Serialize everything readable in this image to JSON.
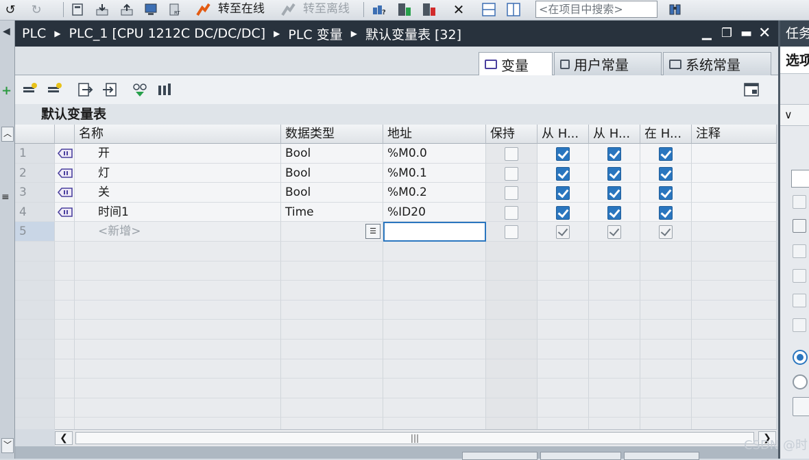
{
  "toolbar": {
    "go_online": "转至在线",
    "go_offline": "转至离线",
    "search_placeholder": "<在项目中搜索>"
  },
  "breadcrumb": [
    "PLC",
    "PLC_1 [CPU 1212C DC/DC/DC]",
    "PLC 变量",
    "默认变量表 [32]"
  ],
  "right_panel": {
    "title": "任务",
    "subtitle": "选项"
  },
  "tabs": [
    {
      "label": "变量",
      "active": true
    },
    {
      "label": "用户常量",
      "active": false
    },
    {
      "label": "系统常量",
      "active": false
    }
  ],
  "table_title": "默认变量表",
  "columns": [
    "名称",
    "数据类型",
    "地址",
    "保持",
    "从 H...",
    "从 H...",
    "在 H...",
    "注释"
  ],
  "rows": [
    {
      "num": "1",
      "name": "开",
      "type": "Bool",
      "address": "%M0.0",
      "retain": false,
      "hmi1": true,
      "hmi2": true,
      "hmi3": true,
      "comment": ""
    },
    {
      "num": "2",
      "name": "灯",
      "type": "Bool",
      "address": "%M0.1",
      "retain": false,
      "hmi1": true,
      "hmi2": true,
      "hmi3": true,
      "comment": ""
    },
    {
      "num": "3",
      "name": "关",
      "type": "Bool",
      "address": "%M0.2",
      "retain": false,
      "hmi1": true,
      "hmi2": true,
      "hmi3": true,
      "comment": ""
    },
    {
      "num": "4",
      "name": "时间1",
      "type": "Time",
      "address": "%ID20",
      "retain": false,
      "hmi1": true,
      "hmi2": true,
      "hmi3": true,
      "comment": ""
    }
  ],
  "new_row": {
    "num": "5",
    "name": "<新增>"
  },
  "watermark": "CSDN @时"
}
